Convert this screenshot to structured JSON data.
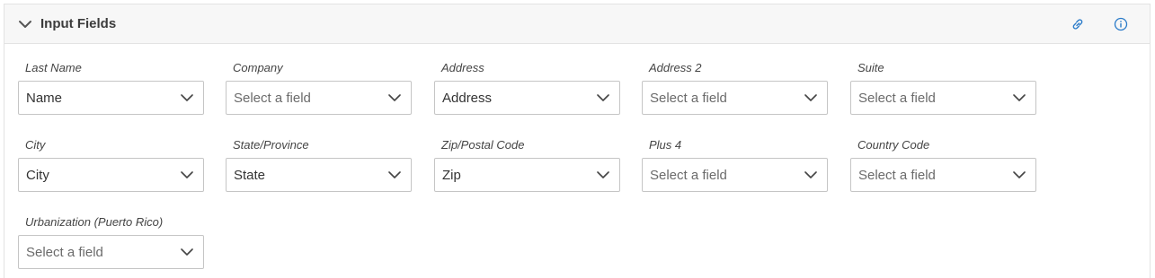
{
  "panel": {
    "title": "Input Fields",
    "accent_color": "#2a7bc9"
  },
  "fields": [
    {
      "label": "Last Name",
      "value": "Name",
      "is_placeholder": false
    },
    {
      "label": "Company",
      "value": "Select a field",
      "is_placeholder": true
    },
    {
      "label": "Address",
      "value": "Address",
      "is_placeholder": false
    },
    {
      "label": "Address 2",
      "value": "Select a field",
      "is_placeholder": true
    },
    {
      "label": "Suite",
      "value": "Select a field",
      "is_placeholder": true
    },
    {
      "label": "City",
      "value": "City",
      "is_placeholder": false
    },
    {
      "label": "State/Province",
      "value": "State",
      "is_placeholder": false
    },
    {
      "label": "Zip/Postal Code",
      "value": "Zip",
      "is_placeholder": false
    },
    {
      "label": "Plus 4",
      "value": "Select a field",
      "is_placeholder": true
    },
    {
      "label": "Country Code",
      "value": "Select a field",
      "is_placeholder": true
    },
    {
      "label": "Urbanization (Puerto Rico)",
      "value": "Select a field",
      "is_placeholder": true
    }
  ],
  "icons": {
    "collapse": "chevron-down-icon",
    "link": "link-icon",
    "info": "info-icon",
    "select": "chevron-down-icon"
  }
}
